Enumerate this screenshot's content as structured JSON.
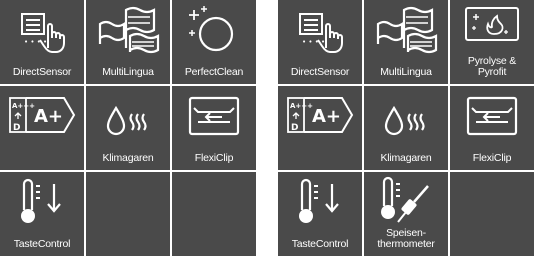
{
  "left": {
    "tiles": [
      {
        "icon": "direct-sensor-icon",
        "label": "DirectSensor"
      },
      {
        "icon": "multilingua-icon",
        "label": "MultiLingua"
      },
      {
        "icon": "perfect-clean-icon",
        "label": "PerfectClean"
      },
      {
        "icon": "energy-label-icon",
        "label": "",
        "energy": {
          "top": "A+++",
          "bottom": "D",
          "class": "A+"
        }
      },
      {
        "icon": "klimagaren-icon",
        "label": "Klimagaren"
      },
      {
        "icon": "flexiclip-icon",
        "label": "FlexiClip"
      },
      {
        "icon": "taste-control-icon",
        "label": "TasteControl"
      },
      {
        "icon": "",
        "label": ""
      },
      {
        "icon": "",
        "label": ""
      }
    ]
  },
  "right": {
    "tiles": [
      {
        "icon": "direct-sensor-icon",
        "label": "DirectSensor"
      },
      {
        "icon": "multilingua-icon",
        "label": "MultiLingua"
      },
      {
        "icon": "pyrolyse-icon",
        "label": "Pyrolyse &\nPyrofit"
      },
      {
        "icon": "energy-label-icon",
        "label": "",
        "energy": {
          "top": "A+++",
          "bottom": "D",
          "class": "A+"
        }
      },
      {
        "icon": "klimagaren-icon",
        "label": "Klimagaren"
      },
      {
        "icon": "flexiclip-icon",
        "label": "FlexiClip"
      },
      {
        "icon": "taste-control-icon",
        "label": "TasteControl"
      },
      {
        "icon": "food-probe-icon",
        "label": "Speisen-\nthermometer"
      },
      {
        "icon": "",
        "label": ""
      }
    ]
  }
}
